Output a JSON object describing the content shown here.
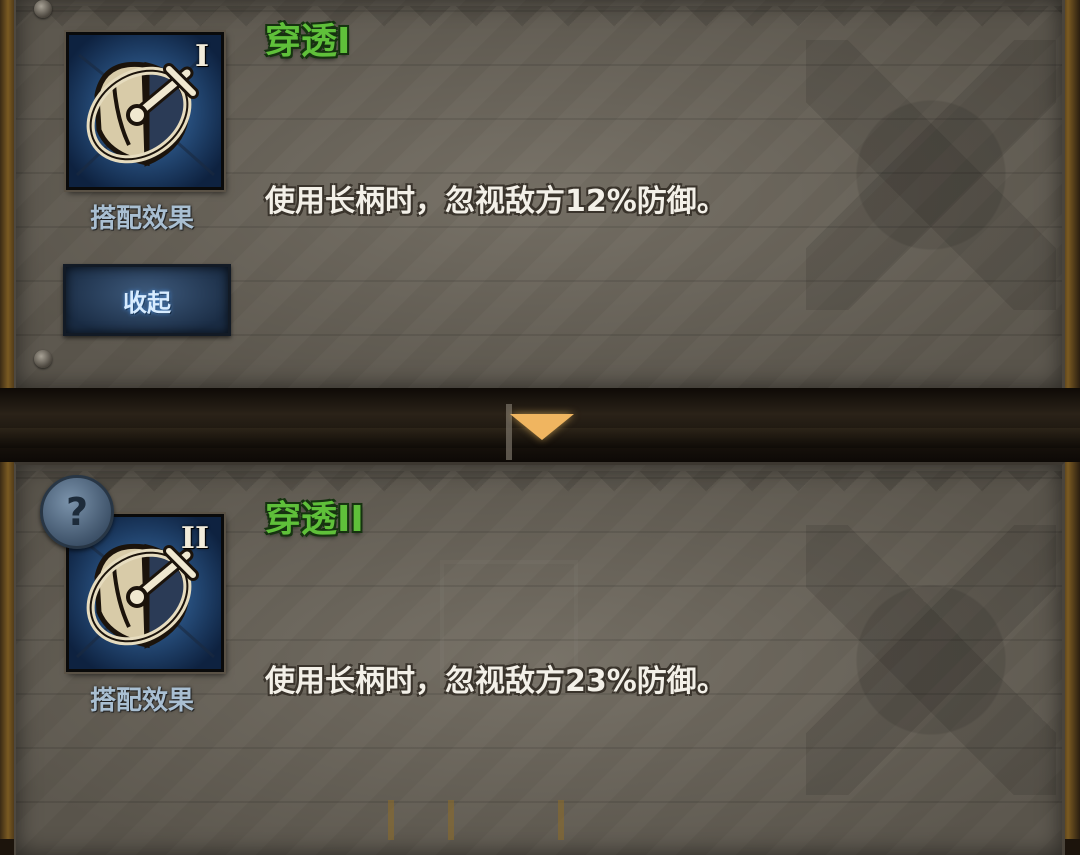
{
  "cards": [
    {
      "title": "穿透I",
      "rank_numeral": "I",
      "icon": "shield-sword-icon",
      "icon_label": "搭配效果",
      "description": "使用长柄时，忽视敌方12%防御。",
      "collapse_button": "收起"
    },
    {
      "title": "穿透II",
      "rank_numeral": "II",
      "icon": "shield-sword-icon",
      "icon_label": "搭配效果",
      "description": "使用长柄时，忽视敌方23%防御。",
      "help_icon": "?"
    }
  ],
  "colors": {
    "title_green": "#5fc03a",
    "description_text": "#f3f0e8",
    "icon_label": "#a9bfd2",
    "button_blue": "#2e4a6c",
    "arrow_gold": "#f0b560",
    "panel": "#6c665b"
  }
}
